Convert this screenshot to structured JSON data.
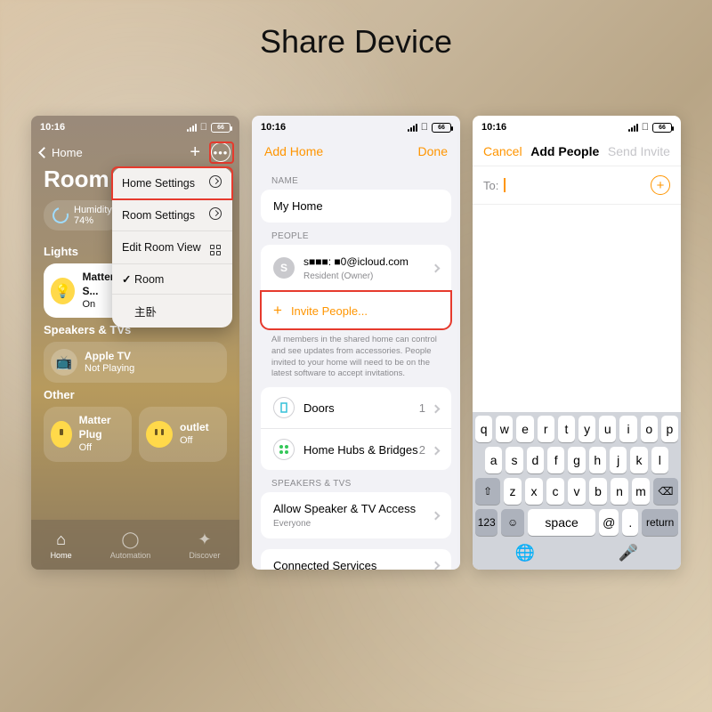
{
  "title": "Share Device",
  "status": {
    "time": "10:16",
    "battery": "66"
  },
  "phone1": {
    "back_label": "Home",
    "room_title": "Room",
    "humidity_label": "Humidity",
    "humidity_value": "74%",
    "section_lights": "Lights",
    "light_tile": {
      "name": "Matter S...",
      "state": "On"
    },
    "section_speakers": "Speakers & TVs",
    "atv_tile": {
      "name": "Apple  TV",
      "state": "Not Playing"
    },
    "section_other": "Other",
    "other_tiles": [
      {
        "name": "Matter Plug",
        "state": "Off"
      },
      {
        "name": "outlet",
        "state": "Off"
      }
    ],
    "tabs": {
      "home": "Home",
      "automation": "Automation",
      "discover": "Discover"
    },
    "menu": {
      "home_settings": "Home Settings",
      "room_settings": "Room Settings",
      "edit_room_view": "Edit Room View",
      "room": "Room",
      "bedroom": "主卧"
    }
  },
  "phone2": {
    "add_home": "Add Home",
    "done": "Done",
    "name_header": "NAME",
    "home_name": "My Home",
    "people_header": "PEOPLE",
    "owner_email": "s■■■:  ■0@icloud.com",
    "owner_role": "Resident (Owner)",
    "owner_initial": "S",
    "invite_label": "Invite People...",
    "people_footer": "All members in the shared home can control and see updates from accessories. People invited to your home will need to be on the latest software to accept invitations.",
    "doors": {
      "label": "Doors",
      "count": "1"
    },
    "hubs": {
      "label": "Home Hubs & Bridges",
      "count": "2"
    },
    "speakers_header": "SPEAKERS & TVS",
    "speaker_access_label": "Allow Speaker & TV Access",
    "speaker_access_value": "Everyone",
    "connected_services": "Connected Services"
  },
  "phone3": {
    "cancel": "Cancel",
    "title": "Add People",
    "send": "Send Invite",
    "to_label": "To:",
    "keyboard": {
      "row1": [
        "q",
        "w",
        "e",
        "r",
        "t",
        "y",
        "u",
        "i",
        "o",
        "p"
      ],
      "row2": [
        "a",
        "s",
        "d",
        "f",
        "g",
        "h",
        "j",
        "k",
        "l"
      ],
      "row3": [
        "z",
        "x",
        "c",
        "v",
        "b",
        "n",
        "m"
      ],
      "shift": "⇧",
      "del": "⌫",
      "num": "123",
      "at": "@",
      "dot": ".",
      "space": "space",
      "return": "return"
    }
  }
}
